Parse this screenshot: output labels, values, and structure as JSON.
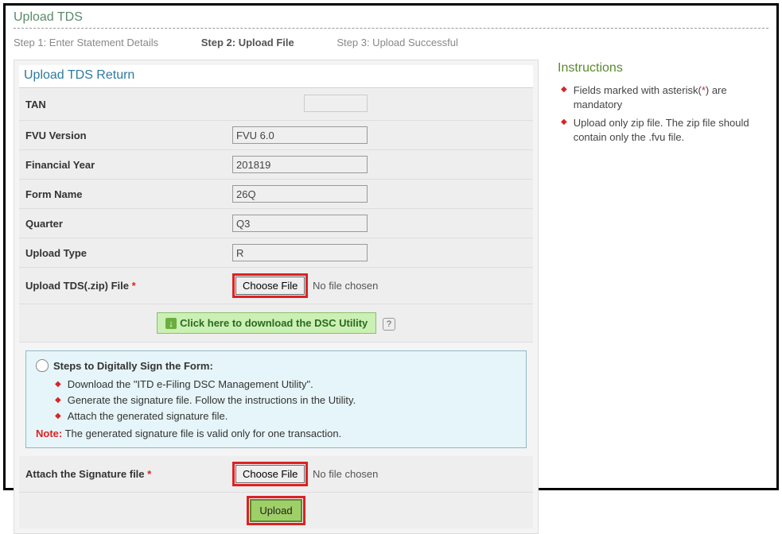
{
  "page": {
    "title": "Upload TDS"
  },
  "wizard": {
    "step1": "Step 1: Enter Statement Details",
    "step2": "Step 2: Upload File",
    "step3": "Step 3: Upload Successful"
  },
  "section": {
    "title": "Upload TDS Return"
  },
  "labels": {
    "tan": "TAN",
    "fvu": "FVU Version",
    "finyear": "Financial Year",
    "formname": "Form Name",
    "quarter": "Quarter",
    "uploadtype": "Upload Type",
    "uploadzip": "Upload TDS(.zip) File ",
    "attachsig": "Attach the Signature file "
  },
  "values": {
    "tan": "",
    "fvu": "FVU 6.0",
    "finyear": "201819",
    "formname": "26Q",
    "quarter": "Q3",
    "uploadtype": "R"
  },
  "file": {
    "choose": "Choose File",
    "nofile": "No file chosen"
  },
  "dsc": {
    "link": "Click here to download the DSC Utility"
  },
  "infobox": {
    "title": "Steps to Digitally Sign the Form:",
    "b1": "Download the \"ITD e-Filing DSC Management Utility\".",
    "b2": "Generate the signature file. Follow the instructions in the Utility.",
    "b3": "Attach the generated signature file.",
    "noteLabel": "Note:",
    "noteText": " The generated signature file is valid only for one transaction."
  },
  "buttons": {
    "upload": "Upload"
  },
  "instructions": {
    "title": "Instructions",
    "i1a": "Fields marked with asterisk",
    "i1b": ") are mandatory",
    "i2": "Upload only zip file. The zip file should contain only the .fvu file."
  },
  "asterisk": "*",
  "asteriskParen": "("
}
